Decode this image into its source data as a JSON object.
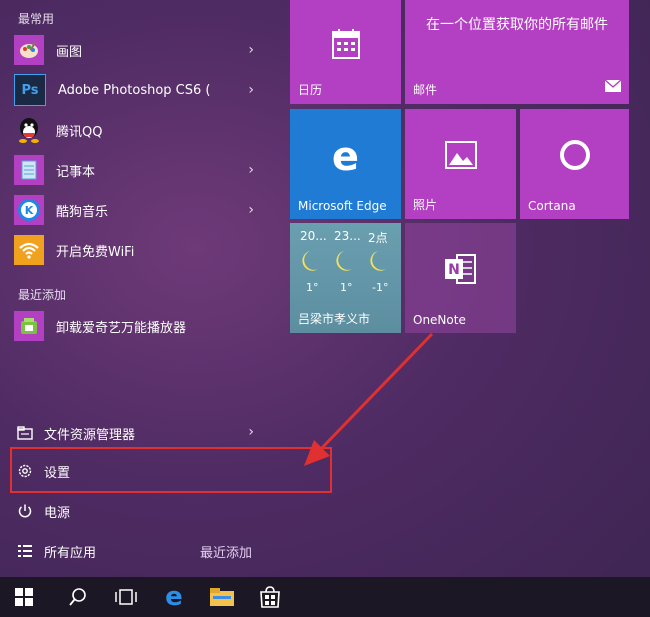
{
  "sections": {
    "most_used": "最常用",
    "recently_added": "最近添加"
  },
  "apps": [
    {
      "label": "画图",
      "icon": "paint-icon",
      "chevron": "›",
      "color": "#b33fc2"
    },
    {
      "label": "Adobe Photoshop CS6 (",
      "icon": "photoshop-icon",
      "chevron": "›",
      "color": "#1b2a44"
    },
    {
      "label": "腾讯QQ",
      "icon": "qq-icon",
      "chevron": "",
      "color": "transparent"
    },
    {
      "label": "记事本",
      "icon": "notepad-icon",
      "chevron": "›",
      "color": "#b33fc2"
    },
    {
      "label": "酷狗音乐",
      "icon": "kugou-icon",
      "chevron": "›",
      "color": "#b33fc2"
    },
    {
      "label": "开启免费WiFi",
      "icon": "wifi-icon",
      "chevron": "",
      "color": "#f0a21f"
    }
  ],
  "recent_app": {
    "label": "卸载爱奇艺万能播放器",
    "icon": "uninstaller-icon",
    "color": "#b33fc2"
  },
  "bottom": {
    "explorer": "文件资源管理器",
    "explorer_chevron": "›",
    "settings": "设置",
    "power": "电源",
    "all_apps": "所有应用",
    "recent_link": "最近添加"
  },
  "tiles": {
    "calendar": "日历",
    "mail_title": "在一个位置获取你的所有邮件",
    "mail_label": "邮件",
    "edge_letter": "e",
    "edge": "Microsoft Edge",
    "photos": "照片",
    "cortana": "Cortana",
    "onenote": "OneNote",
    "onenote_letter": "N",
    "weather_location": "吕梁市孝义市",
    "weather": [
      {
        "time": "20...",
        "temp": "1°"
      },
      {
        "time": "23...",
        "temp": "1°"
      },
      {
        "time": "2点",
        "temp": "-1°"
      }
    ]
  },
  "colors": {
    "tile_purple": "#b33fc2",
    "tile_blue": "#1f7bd4",
    "highlight": "#e0302f",
    "taskbar": "#1c1724"
  }
}
